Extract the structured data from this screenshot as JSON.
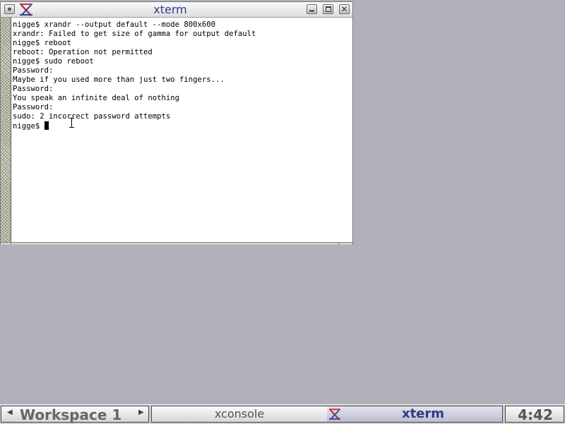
{
  "window": {
    "title": "xterm",
    "icon": "x-logo-icon"
  },
  "terminal": {
    "lines": [
      "nigge$ xrandr --output default --mode 800x600",
      "xrandr: Failed to get size of gamma for output default",
      "nigge$ reboot",
      "reboot: Operation not permitted",
      "nigge$ sudo reboot",
      "Password:",
      "Maybe if you used more than just two fingers...",
      "Password:",
      "You speak an infinite deal of nothing",
      "Password:",
      "sudo: 2 incorrect password attempts"
    ],
    "prompt": "nigge$ "
  },
  "taskbar": {
    "workspace": "Workspace 1",
    "tasks": [
      {
        "label": "xconsole",
        "active": false
      },
      {
        "label": "xterm",
        "active": true,
        "icon": "x-logo-icon"
      }
    ],
    "clock": "4:42"
  },
  "colors": {
    "desktop": "#b0b0bb",
    "title_text": "#2d3a8c",
    "x_logo_red": "#c0303a",
    "x_logo_blue": "#3040a0"
  }
}
